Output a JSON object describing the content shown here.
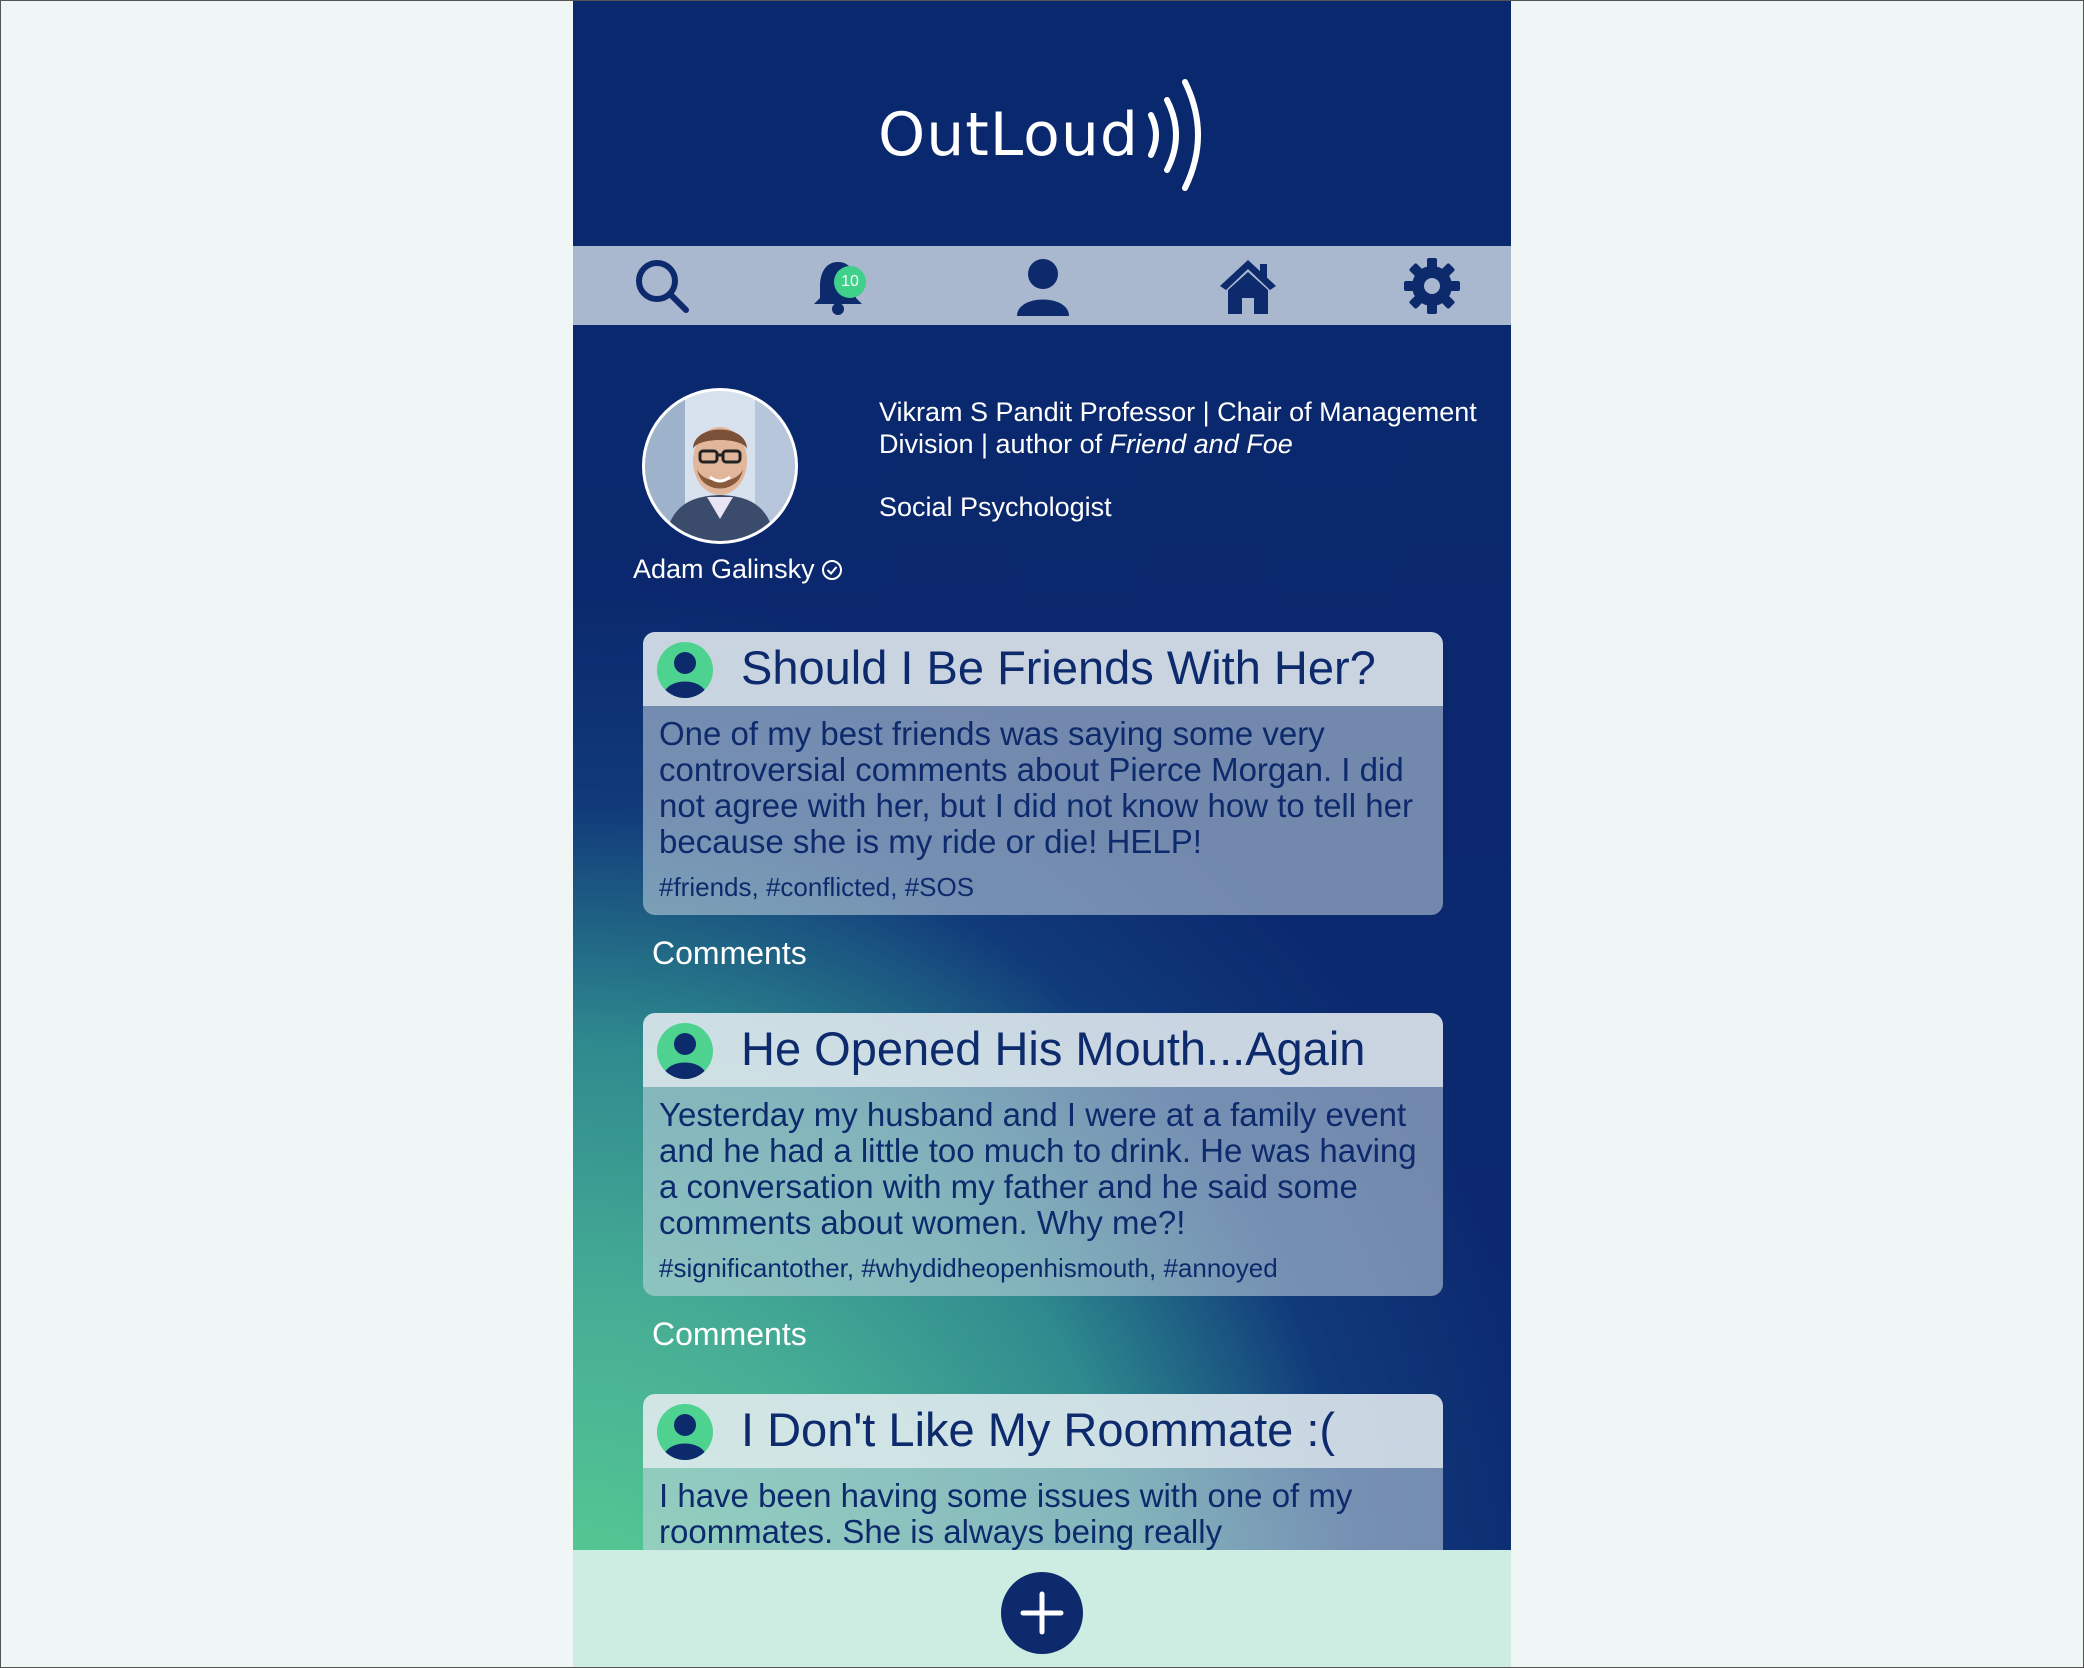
{
  "app": {
    "logo_text": "OutLoud"
  },
  "nav": {
    "notifications_count": "10",
    "items": [
      {
        "icon": "search-icon"
      },
      {
        "icon": "bell-icon"
      },
      {
        "icon": "user-icon"
      },
      {
        "icon": "home-icon"
      },
      {
        "icon": "gear-icon"
      }
    ]
  },
  "profile": {
    "name": "Adam Galinsky",
    "verified_icon": "verified-check-icon",
    "bio_prefix": "Vikram S Pandit Professor | Chair of Management Division | author of ",
    "bio_book": "Friend and Foe",
    "role": "Social Psychologist"
  },
  "posts": [
    {
      "title": "Should I Be Friends With Her?",
      "body": "One of my best friends was saying some very controversial comments about Pierce Morgan. I did not agree with her, but I did not know how to tell her because she is my ride or die! HELP!",
      "tags": "#friends, #conflicted, #SOS",
      "comments_label": "Comments"
    },
    {
      "title": "He Opened His Mouth...Again",
      "body": "Yesterday my husband and I were at a family event and he had a little too much to drink. He was having a conversation with my father and he said some comments about women. Why me?!",
      "tags": "#significantother, #whydidheopenhismouth, #annoyed",
      "comments_label": "Comments"
    },
    {
      "title": "I Don't Like My Roommate :(",
      "body": "I have been having some issues with one of my roommates. She is always being really",
      "tags": "",
      "comments_label": ""
    }
  ],
  "colors": {
    "brand_navy": "#0a286d",
    "nav_bar": "#a9b7cf",
    "accent_green": "#4ed28f",
    "bottom_bar": "#cdece2"
  }
}
